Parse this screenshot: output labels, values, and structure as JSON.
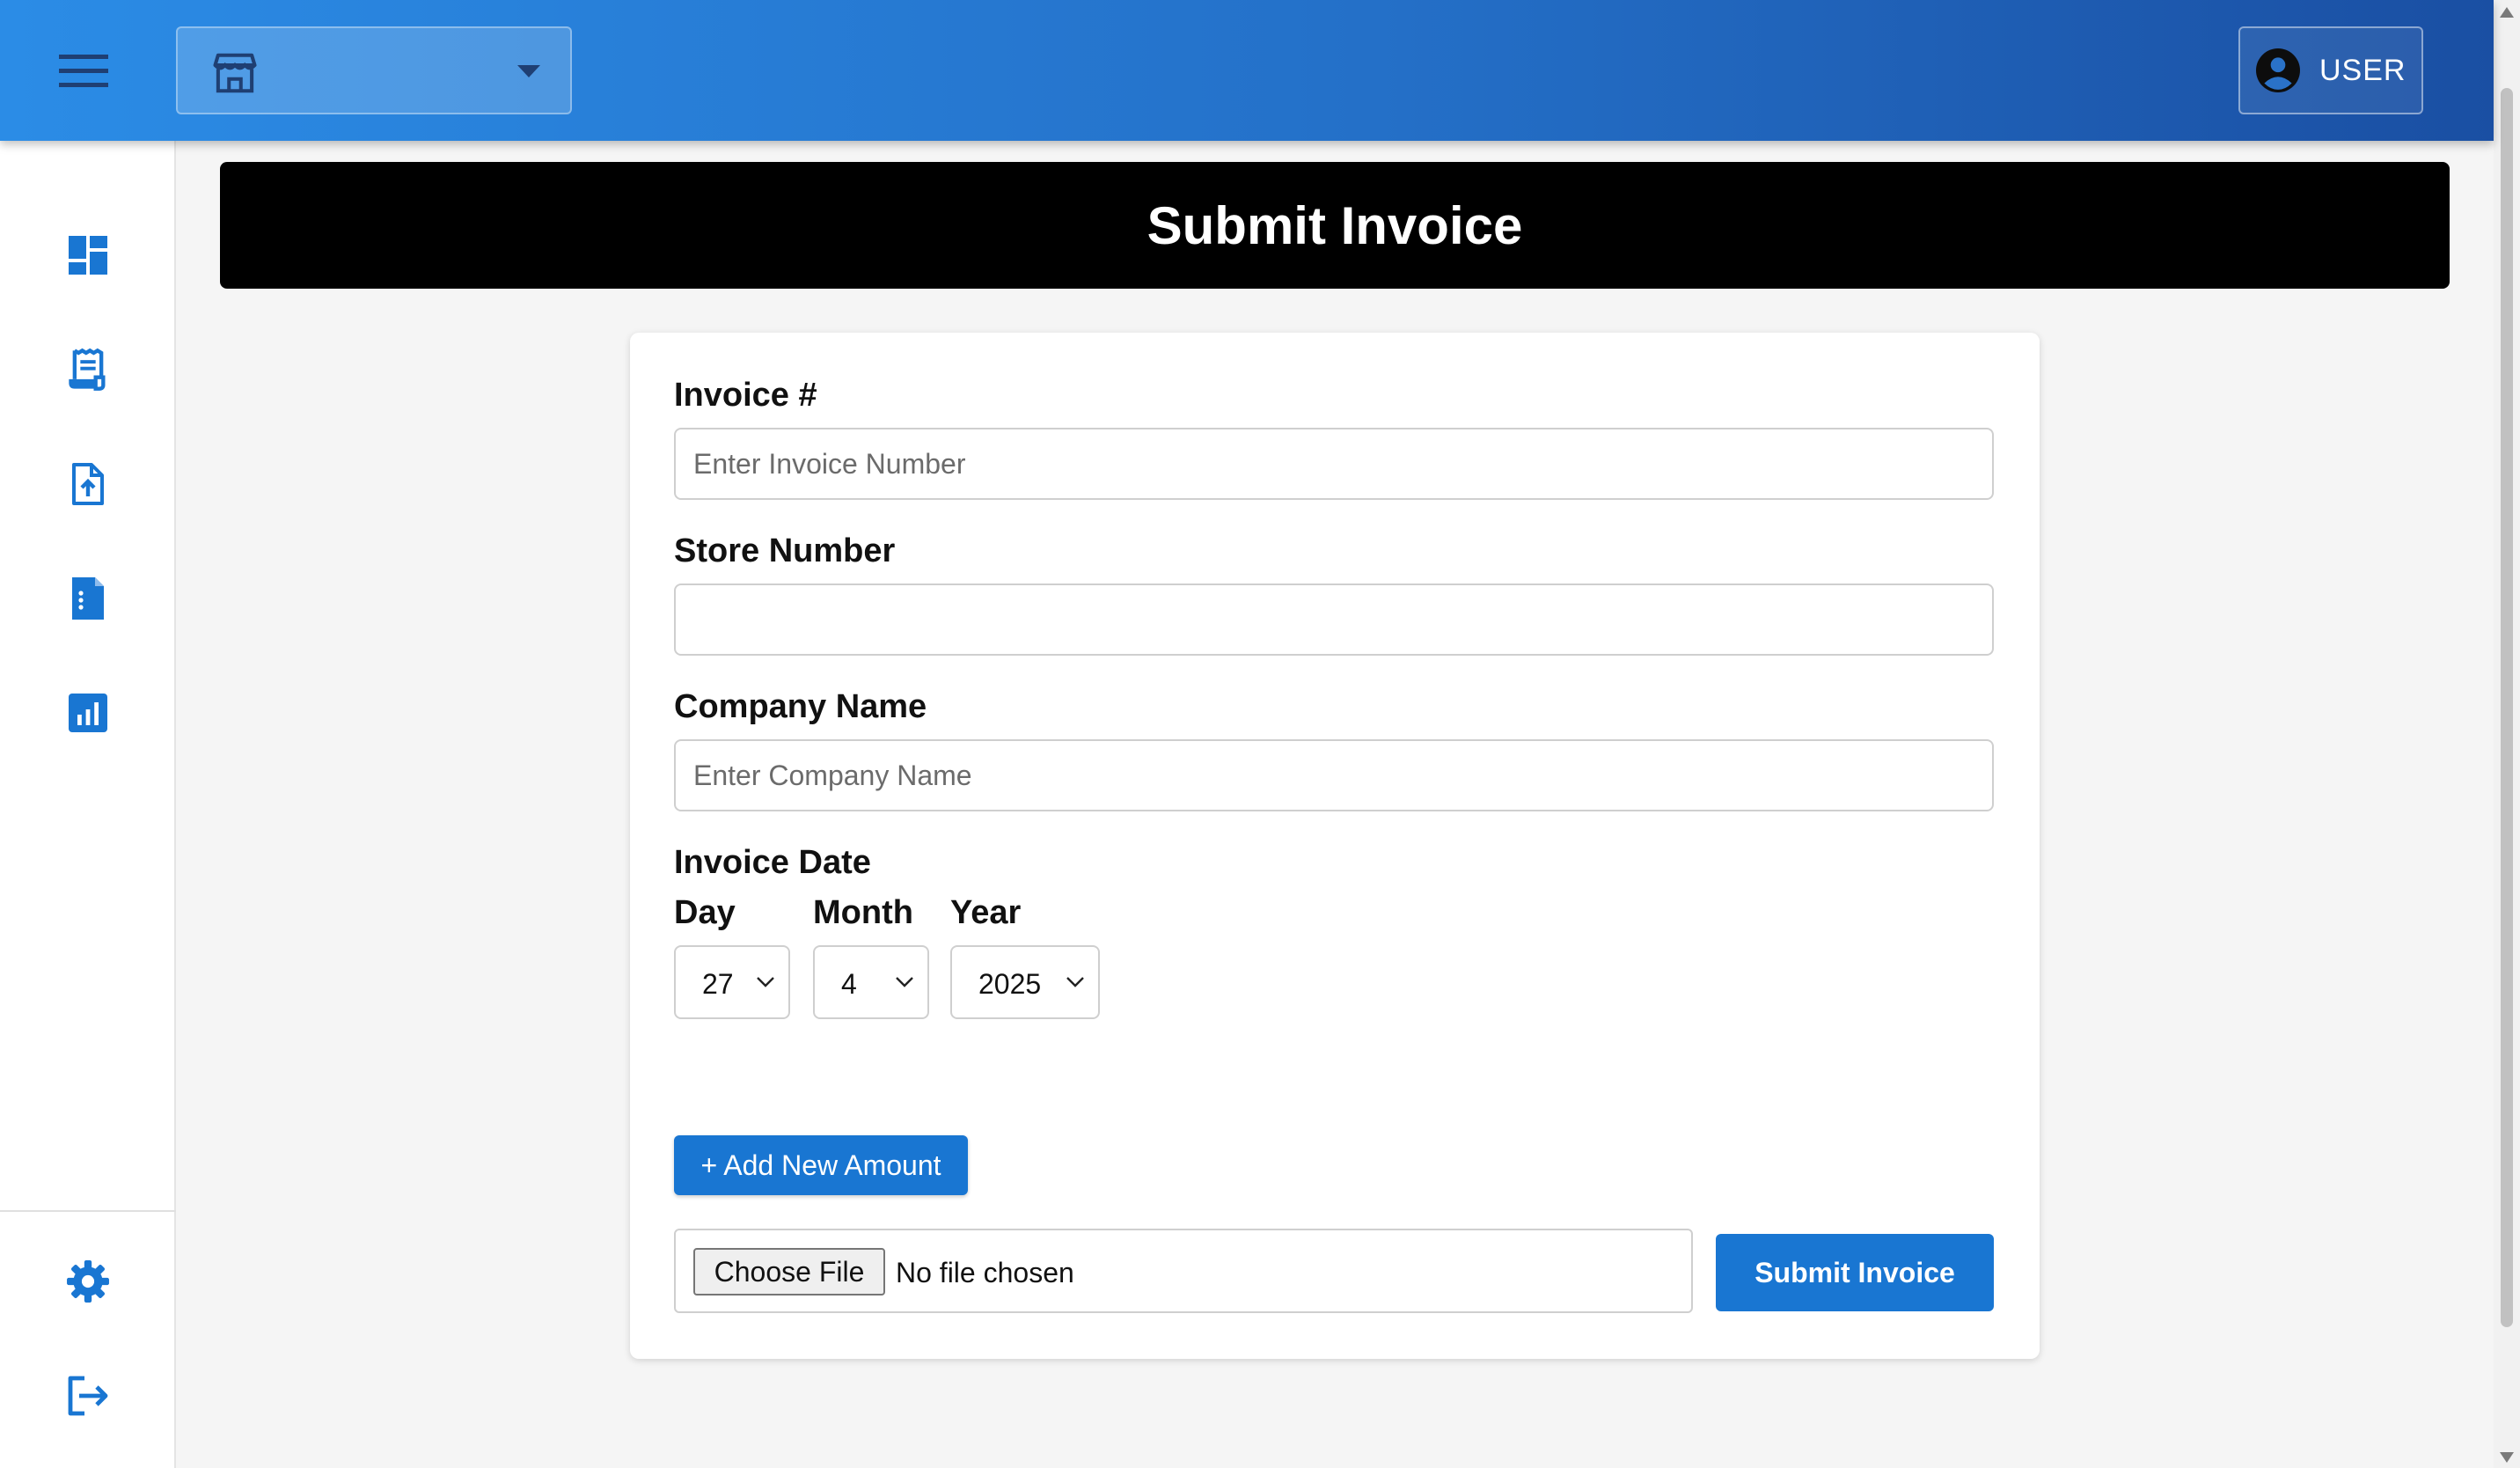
{
  "header": {
    "store_selector": {
      "icon": "store-icon",
      "value": ""
    },
    "user_button": {
      "icon": "account-circle-icon",
      "label": "USER"
    }
  },
  "sidebar": {
    "items": [
      {
        "icon": "dashboard-icon"
      },
      {
        "icon": "receipt-icon"
      },
      {
        "icon": "upload-file-icon"
      },
      {
        "icon": "document-list-icon"
      },
      {
        "icon": "report-chart-icon"
      }
    ],
    "bottom_items": [
      {
        "icon": "settings-gear-icon"
      },
      {
        "icon": "logout-icon"
      }
    ]
  },
  "page": {
    "title": "Submit Invoice"
  },
  "form": {
    "invoice_number": {
      "label": "Invoice #",
      "placeholder": "Enter Invoice Number",
      "value": ""
    },
    "store_number": {
      "label": "Store Number",
      "placeholder": "",
      "value": ""
    },
    "company_name": {
      "label": "Company Name",
      "placeholder": "Enter Company Name",
      "value": ""
    },
    "invoice_date": {
      "label": "Invoice Date",
      "day": {
        "label": "Day",
        "value": "27"
      },
      "month": {
        "label": "Month",
        "value": "4"
      },
      "year": {
        "label": "Year",
        "value": "2025"
      }
    },
    "add_amount_label": "+ Add New Amount",
    "file": {
      "button_label": "Choose File",
      "status": "No file chosen"
    },
    "submit_label": "Submit Invoice"
  },
  "colors": {
    "primary": "#1976d2",
    "appbar_start": "#2b8ce6",
    "appbar_end": "#1a4fa3",
    "title_bar": "#000000"
  }
}
